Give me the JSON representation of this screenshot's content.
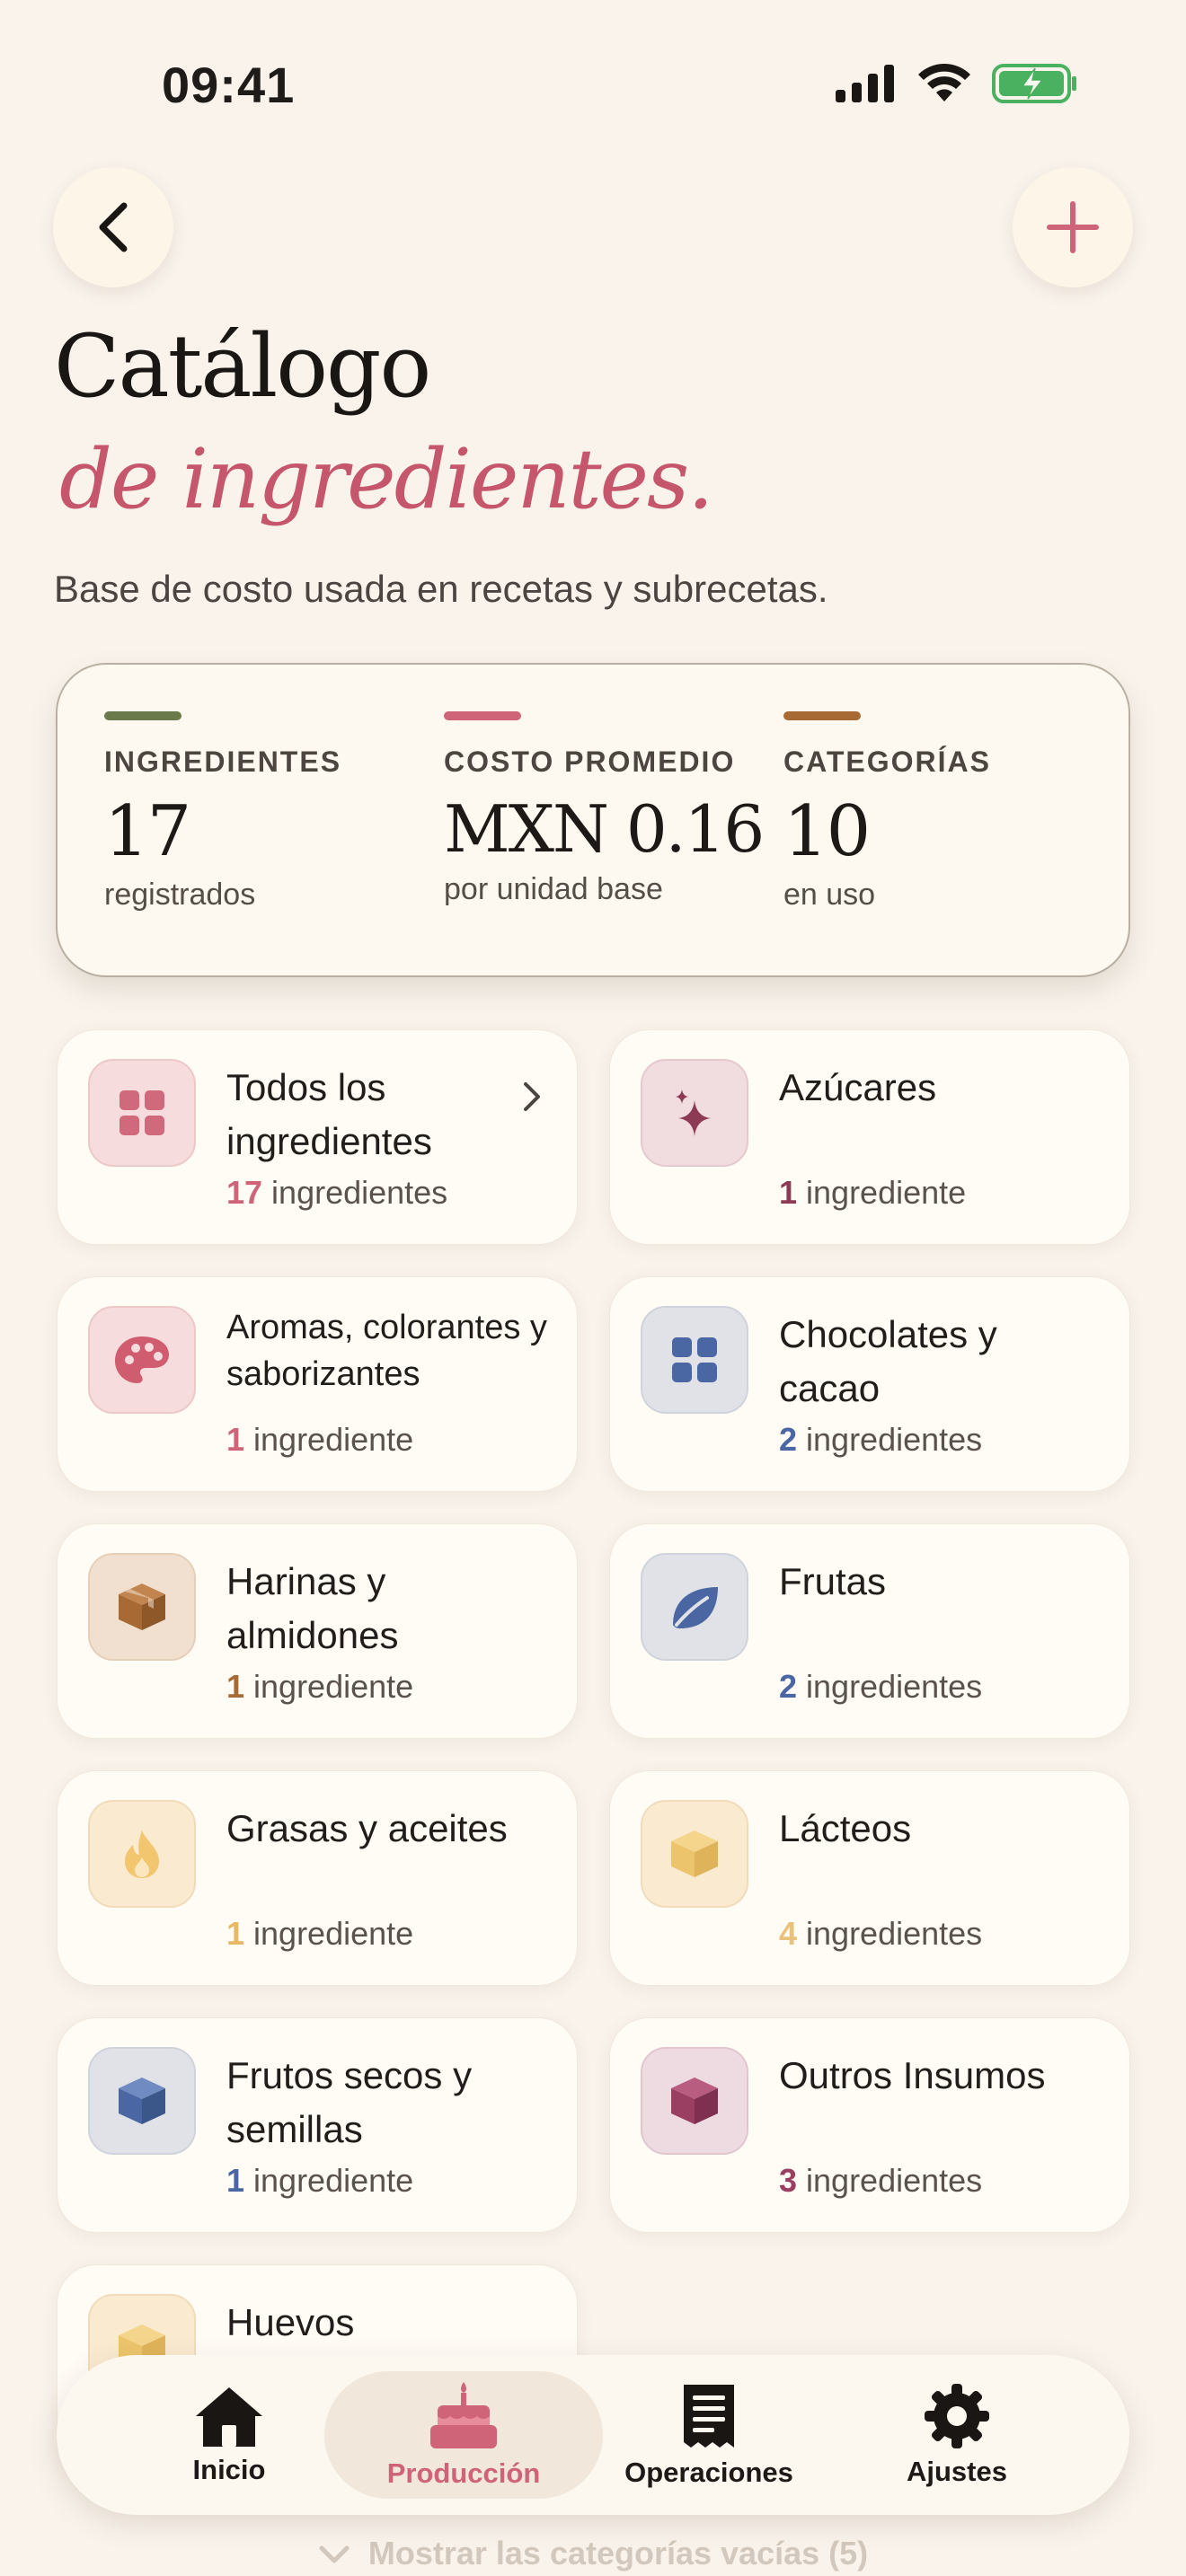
{
  "status": {
    "time": "09:41"
  },
  "header": {
    "title_line1": "Catálogo",
    "title_line2": "de ingredientes.",
    "subtitle": "Base de costo usada en recetas y subrecetas."
  },
  "stats": [
    {
      "label": "INGREDIENTES",
      "value": "17",
      "sub": "registrados",
      "color": "#6b7a4a"
    },
    {
      "label": "COSTO PROMEDIO",
      "value": "MXN 0.16",
      "sub": "por unidad base",
      "color": "#cf6479"
    },
    {
      "label": "CATEGORÍAS",
      "value": "10",
      "sub": "en uso",
      "color": "#a86a34"
    }
  ],
  "categories": [
    {
      "name": "Todos los ingredientes",
      "count": "17",
      "unit": "ingredientes",
      "icon": "grid-icon",
      "icon_bg": "#f6dcdc",
      "accent": "#cf6479"
    },
    {
      "name": "Azúcares",
      "count": "1",
      "unit": "ingrediente",
      "icon": "sparkle-icon",
      "icon_bg": "#f1dce0",
      "accent": "#8d3b55"
    },
    {
      "name": "Aromas, colorantes y saborizantes",
      "count": "1",
      "unit": "ingrediente",
      "icon": "palette-icon",
      "icon_bg": "#f6dcdc",
      "accent": "#cf6479"
    },
    {
      "name": "Chocolates y cacao",
      "count": "2",
      "unit": "ingredientes",
      "icon": "grid-icon",
      "icon_bg": "#e0e2e8",
      "accent": "#4a67a3"
    },
    {
      "name": "Harinas y almidones",
      "count": "1",
      "unit": "ingrediente",
      "icon": "box-icon",
      "icon_bg": "#f1e0cf",
      "accent": "#a86a34"
    },
    {
      "name": "Frutas",
      "count": "2",
      "unit": "ingredientes",
      "icon": "leaf-icon",
      "icon_bg": "#e0e2e8",
      "accent": "#4a67a3"
    },
    {
      "name": "Grasas y aceites",
      "count": "1",
      "unit": "ingrediente",
      "icon": "flame-icon",
      "icon_bg": "#f9ead0",
      "accent": "#e8b864"
    },
    {
      "name": "Lácteos",
      "count": "4",
      "unit": "ingredientes",
      "icon": "box-icon",
      "icon_bg": "#f9ead0",
      "accent": "#e8c27a"
    },
    {
      "name": "Frutos secos y semillas",
      "count": "1",
      "unit": "ingrediente",
      "icon": "box-icon",
      "icon_bg": "#e0e2e8",
      "accent": "#4a67a3"
    },
    {
      "name": "Outros Insumos",
      "count": "3",
      "unit": "ingredientes",
      "icon": "box-icon",
      "icon_bg": "#eedbe1",
      "accent": "#9a3f62"
    },
    {
      "name": "Huevos",
      "count": "",
      "unit": "",
      "icon": "box-icon",
      "icon_bg": "#f9ead0",
      "accent": "#e8c27a"
    }
  ],
  "tabbar": {
    "items": [
      {
        "label": "Inicio",
        "icon": "home-icon"
      },
      {
        "label": "Producción",
        "icon": "cake-icon",
        "active": true
      },
      {
        "label": "Operaciones",
        "icon": "receipt-icon"
      },
      {
        "label": "Ajustes",
        "icon": "gear-icon"
      }
    ]
  },
  "show_empty": "Mostrar las categorías vacías (5)"
}
